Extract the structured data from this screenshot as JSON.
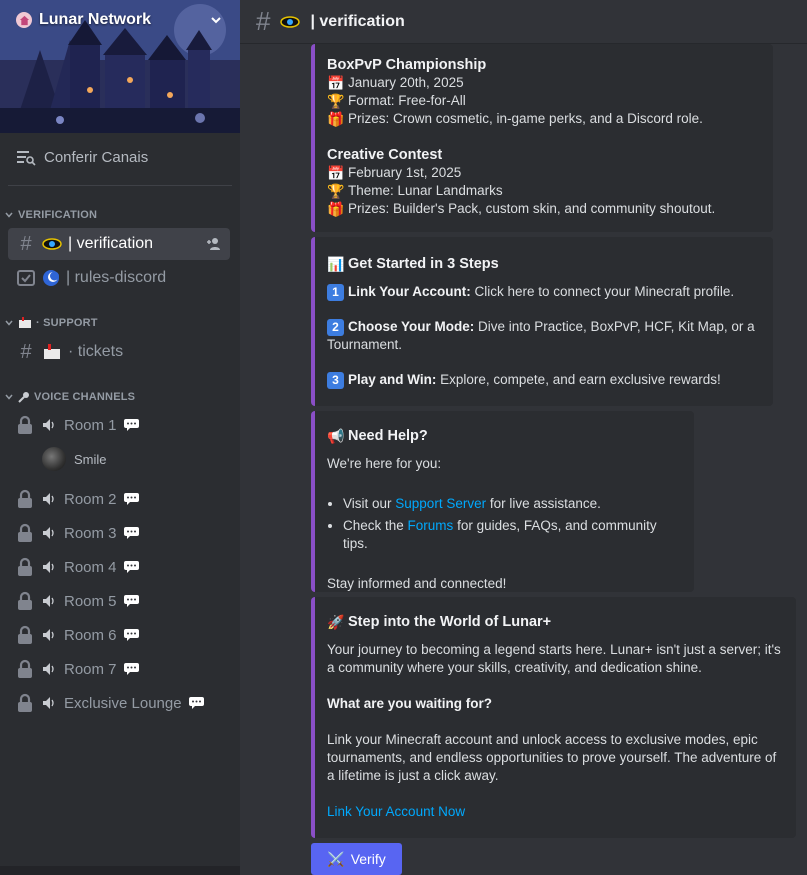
{
  "server": {
    "name": "Lunar Network"
  },
  "sidebar": {
    "browse_label": "Conferir Canais",
    "categories": {
      "verification": "VERIFICATION",
      "support": "· SUPPORT",
      "voice": "VOICE CHANNELS"
    },
    "channels": {
      "verification": "| verification",
      "rules": "| rules-discord",
      "tickets": "· tickets"
    },
    "voice_rooms": [
      "Room 1",
      "Room 2",
      "Room 3",
      "Room 4",
      "Room 5",
      "Room 6",
      "Room 7",
      "Exclusive Lounge"
    ],
    "voice_user": "Smile"
  },
  "header": {
    "channel_title": "| verification"
  },
  "embeds": {
    "events": {
      "boxpvp_title": "BoxPvP Championship",
      "boxpvp_date": "January 20th, 2025",
      "boxpvp_format": "Format: Free-for-All",
      "boxpvp_prizes": "Prizes: Crown cosmetic, in-game perks, and a Discord role.",
      "creative_title": "Creative Contest",
      "creative_date": "February 1st, 2025",
      "creative_theme": "Theme: Lunar Landmarks",
      "creative_prizes": "Prizes: Builder's Pack, custom skin, and community shoutout."
    },
    "steps": {
      "title": "Get Started in 3 Steps",
      "s1_bold": "Link Your Account:",
      "s1_text": " Click here to connect your Minecraft profile.",
      "s2_bold": "Choose Your Mode:",
      "s2_text": " Dive into Practice, BoxPvP, HCF, Kit Map, or a Tournament.",
      "s3_bold": "Play and Win:",
      "s3_text": " Explore, compete, and earn exclusive rewards!"
    },
    "help": {
      "title": "Need Help?",
      "intro": "We're here for you:",
      "b1_pre": "Visit our ",
      "b1_link": "Support Server",
      "b1_post": " for live assistance.",
      "b2_pre": "Check the ",
      "b2_link": "Forums",
      "b2_post": " for guides, FAQs, and community tips.",
      "outro": "Stay informed and connected!"
    },
    "world": {
      "title": "Step into the World of Lunar+",
      "p1": "Your journey to becoming a legend starts here. Lunar+ isn't just a server; it's a community where your skills, creativity, and dedication shine.",
      "q": "What are you waiting for?",
      "p2": "Link your Minecraft account and unlock access to exclusive modes, epic tournaments, and endless opportunities to prove yourself. The adventure of a lifetime is just a click away.",
      "link": "Link Your Account Now"
    }
  },
  "verify_button": "Verify",
  "colors": {
    "accent": "#8a4fc7",
    "button": "#5865f2",
    "link": "#00a8fc"
  }
}
